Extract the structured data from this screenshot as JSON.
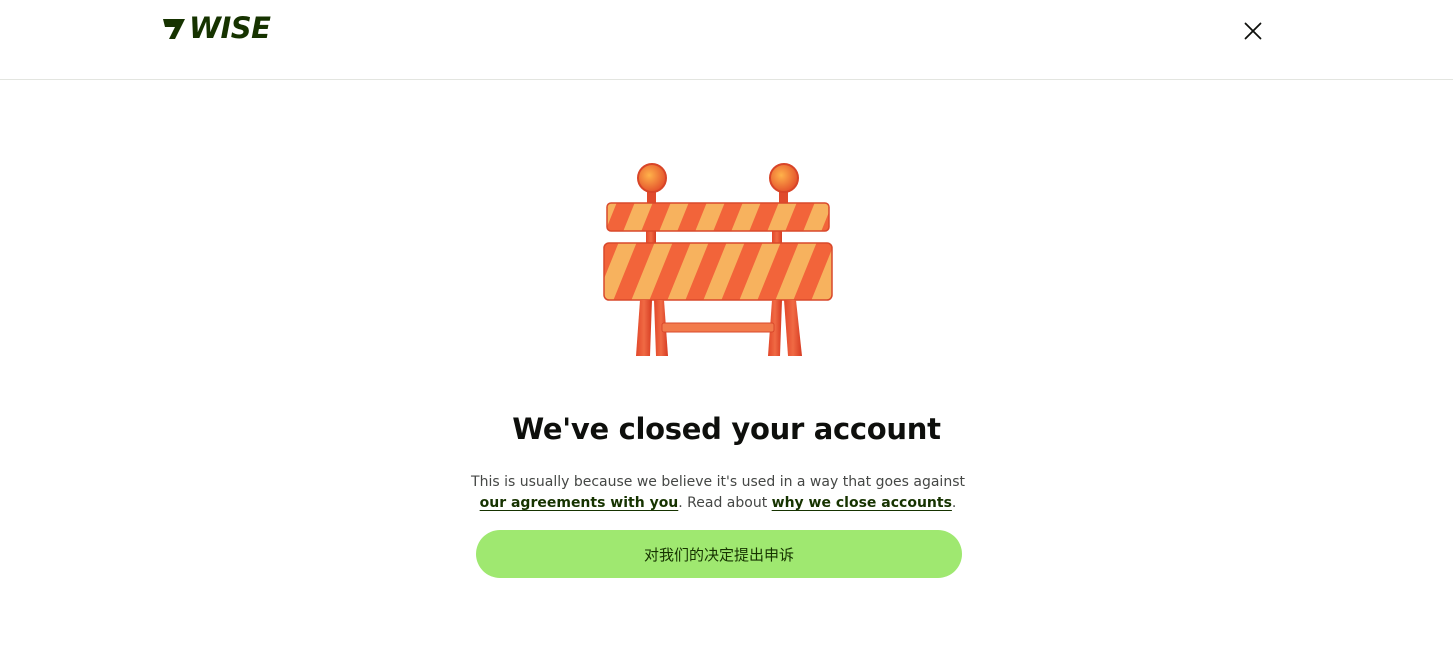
{
  "header": {
    "logo_text": "WISE",
    "close_icon": "close-icon"
  },
  "main": {
    "illustration_icon": "road-barrier-icon",
    "title": "We've closed your account",
    "description": {
      "text_before": "This is usually because we believe it's used in a way that goes against ",
      "link_agreements": "our agreements with you",
      "text_middle": ". Read about ",
      "link_why": "why we close accounts",
      "text_after": "."
    },
    "appeal_button": "对我们的决定提出申诉"
  },
  "colors": {
    "brand_dark_green": "#163300",
    "bright_green": "#9fe870",
    "divider": "#e3e5e0",
    "text_secondary": "#454745"
  }
}
